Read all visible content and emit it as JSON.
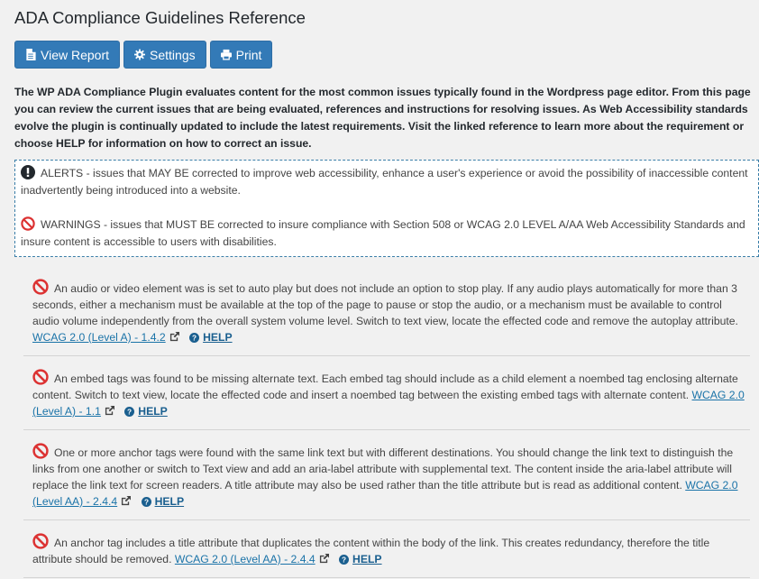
{
  "page": {
    "title": "ADA Compliance Guidelines Reference"
  },
  "toolbar": {
    "view_report": "View Report",
    "settings": "Settings",
    "print": "Print"
  },
  "intro": "The WP ADA Compliance Plugin evaluates content for the most common issues typically found in the Wordpress page editor. From this page you can review the current issues that are being evaluated, references and instructions for resolving issues. As Web Accessibility standards evolve the plugin is continually updated to include the latest requirements. Visit the linked reference to learn more about the requirement or choose HELP for information on how to correct an issue.",
  "legend": {
    "alerts": "ALERTS - issues that MAY BE corrected to improve web accessibility, enhance a user's experience or avoid the possibility of inaccessible content inadvertently being introduced into a website.",
    "warnings": "WARNINGS - issues that MUST BE corrected to insure compliance with Section 508 or WCAG 2.0 LEVEL A/AA Web Accessibility Standards and insure content is accessible to users with disabilities."
  },
  "help_label": "HELP",
  "issues": [
    {
      "text": "An audio or video element was is set to auto play but does not include an option to stop play. If any audio plays automatically for more than 3 seconds, either a mechanism must be available at the top of the page to pause or stop the audio, or a mechanism must be available to control audio volume independently from the overall system volume level. Switch to text view, locate the effected code and remove the autoplay attribute.",
      "ref": "WCAG 2.0 (Level A) - 1.4.2"
    },
    {
      "text": "An embed tags was found to be missing alternate text. Each embed tag should include as a child element a noembed tag enclosing alternate content. Switch to text view, locate the effected code and insert a noembed tag between the existing embed tags with alternate content.",
      "ref": "WCAG 2.0 (Level A) - 1.1"
    },
    {
      "text": "One or more anchor tags were found with the same link text but with different destinations. You should change the link text to distinguish the links from one another or switch to Text view and add an aria-label attribute with supplemental text. The content inside the aria-label attribute will replace the link text for screen readers. A title attribute may also be used rather than the title attribute but is read as additional content.",
      "ref": "WCAG 2.0 (Level AA) - 2.4.4"
    },
    {
      "text": "An anchor tag includes a title attribute that duplicates the content within the body of the link. This creates redundancy, therefore the title attribute should be removed.",
      "ref": "WCAG 2.0 (Level AA) - 2.4.4"
    }
  ],
  "colors": {
    "button": "#337ab7",
    "warning_icon": "#dc3232",
    "link": "#1a73a8",
    "legend_border": "#3a7ea8"
  }
}
